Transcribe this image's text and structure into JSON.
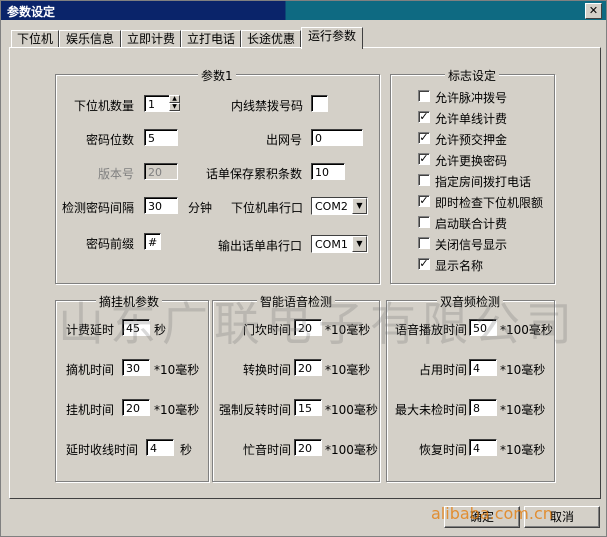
{
  "window": {
    "title": "参数设定",
    "close_glyph": "✕"
  },
  "tabs": [
    "下位机",
    "娱乐信息",
    "立即计费",
    "立打电话",
    "长途优惠",
    "运行参数"
  ],
  "params1": {
    "title": "参数1",
    "slave_count_label": "下位机数量",
    "slave_count": "1",
    "internal_forbidden_label": "内线禁拨号码",
    "internal_forbidden": "",
    "pwd_digits_label": "密码位数",
    "pwd_digits": "5",
    "outline_label": "出网号",
    "outline": "0",
    "version_label": "版本号",
    "version": "20",
    "bill_accum_label": "话单保存累积条数",
    "bill_accum": "10",
    "pwd_interval_label": "检测密码间隔",
    "pwd_interval": "30",
    "pwd_interval_unit": "分钟",
    "slave_port_label": "下位机串行口",
    "slave_port": "COM2",
    "pwd_prefix_label": "密码前缀",
    "pwd_prefix": "#",
    "bill_port_label": "输出话单串行口",
    "bill_port": "COM1"
  },
  "flags": {
    "title": "标志设定",
    "items": [
      {
        "label": "允许脉冲拨号",
        "checked": false
      },
      {
        "label": "允许单线计费",
        "checked": true
      },
      {
        "label": "允许预交押金",
        "checked": true
      },
      {
        "label": "允许更换密码",
        "checked": true
      },
      {
        "label": "指定房间拨打电话",
        "checked": false
      },
      {
        "label": "即时检查下位机限额",
        "checked": true
      },
      {
        "label": "启动联合计费",
        "checked": false
      },
      {
        "label": "关闭信号显示",
        "checked": false
      },
      {
        "label": "显示名称",
        "checked": true
      }
    ]
  },
  "hook": {
    "title": "摘挂机参数",
    "rows": [
      {
        "label": "计费延时",
        "value": "45",
        "unit": "秒"
      },
      {
        "label": "摘机时间",
        "value": "30",
        "unit": "*10毫秒"
      },
      {
        "label": "挂机时间",
        "value": "20",
        "unit": "*10毫秒"
      },
      {
        "label": "延时收线时间",
        "value": "4",
        "unit": "秒"
      }
    ]
  },
  "voice": {
    "title": "智能语音检测",
    "rows": [
      {
        "label": "门坎时间",
        "value": "20",
        "unit": "*10毫秒"
      },
      {
        "label": "转换时间",
        "value": "20",
        "unit": "*10毫秒"
      },
      {
        "label": "强制反转时间",
        "value": "15",
        "unit": "*100毫秒"
      },
      {
        "label": "忙音时间",
        "value": "20",
        "unit": "*100毫秒"
      }
    ]
  },
  "dtmf": {
    "title": "双音频检测",
    "rows": [
      {
        "label": "语音播放时间",
        "value": "50",
        "unit": "*100毫秒"
      },
      {
        "label": "占用时间",
        "value": "4",
        "unit": "*10毫秒"
      },
      {
        "label": "最大未检时间",
        "value": "8",
        "unit": "*10毫秒"
      },
      {
        "label": "恢复时间",
        "value": "4",
        "unit": "*10毫秒"
      }
    ]
  },
  "buttons": {
    "ok": "确定",
    "cancel": "取消"
  },
  "watermark": "山东广联电子有限公司",
  "watermark2": "alibaba.com.cn"
}
